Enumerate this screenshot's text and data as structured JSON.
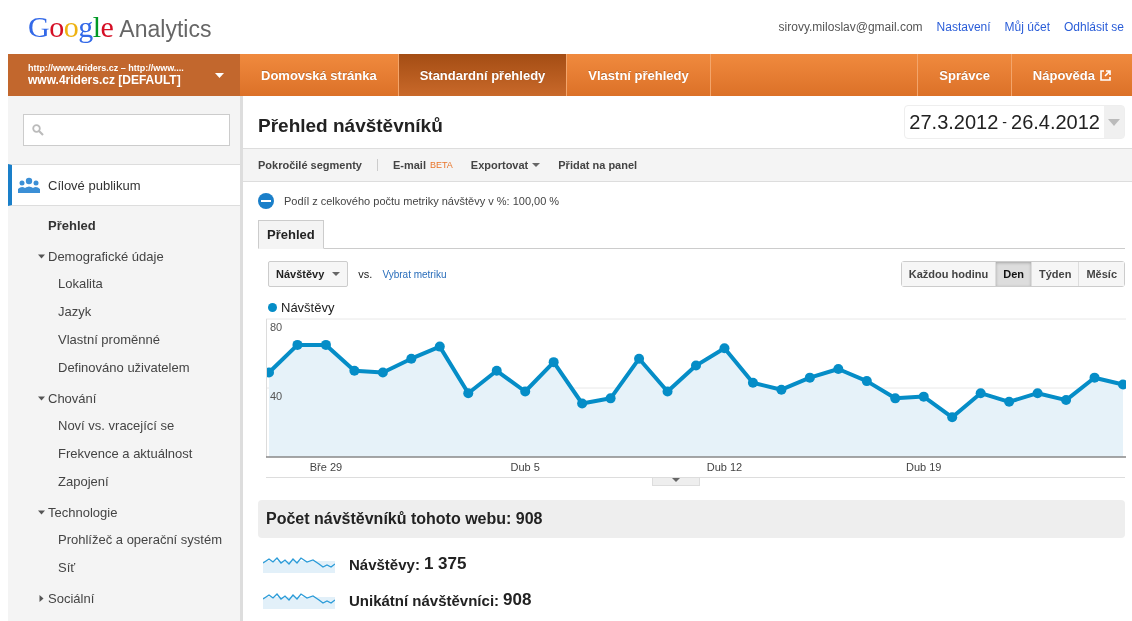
{
  "header": {
    "logo_brand": "Google",
    "logo_product": "Analytics",
    "email": "sirovy.miloslav@gmail.com",
    "links": [
      "Nastavení",
      "Můj účet",
      "Odhlásit se"
    ]
  },
  "nav": {
    "account": {
      "line1": "http://www.4riders.cz – http://www....",
      "line2": "www.4riders.cz [DEFAULT]"
    },
    "tabs": [
      {
        "label": "Domovská stránka",
        "selected": false
      },
      {
        "label": "Standardní přehledy",
        "selected": true
      },
      {
        "label": "Vlastní přehledy",
        "selected": false
      }
    ],
    "right_tabs": [
      {
        "label": "Správce",
        "external": false
      },
      {
        "label": "Nápověda",
        "external": true
      }
    ]
  },
  "sidebar": {
    "section": "Cílové publikum",
    "items": [
      {
        "label": "Přehled",
        "selected": true
      },
      {
        "label": "Demografické údaje",
        "expanded": true,
        "children": [
          {
            "label": "Lokalita",
            "selected": false
          },
          {
            "label": "Jazyk",
            "selected": false
          },
          {
            "label": "Vlastní proměnné",
            "selected": false
          },
          {
            "label": "Definováno uživatelem",
            "selected": false
          }
        ]
      },
      {
        "label": "Chování",
        "expanded": true,
        "children": [
          {
            "label": "Noví vs. vracející se",
            "selected": false
          },
          {
            "label": "Frekvence a aktuálnost",
            "selected": false
          },
          {
            "label": "Zapojení",
            "selected": false
          }
        ]
      },
      {
        "label": "Technologie",
        "expanded": true,
        "children": [
          {
            "label": "Prohlížeč a operační systém",
            "selected": false
          },
          {
            "label": "Síť",
            "selected": false
          }
        ]
      },
      {
        "label": "Sociální",
        "expanded": false
      }
    ]
  },
  "main": {
    "title": "Přehled návštěvníků",
    "date_range": {
      "start": "27.3.2012",
      "separator": "-",
      "end": "26.4.2012"
    },
    "toolbar": [
      {
        "kind": "plain",
        "label": "Pokročilé segmenty"
      },
      {
        "kind": "badge",
        "label": "E-mail",
        "badge": "BETA"
      },
      {
        "kind": "dropdown",
        "label": "Exportovat"
      },
      {
        "kind": "plain",
        "label": "Přidat na panel"
      }
    ],
    "segment_note": "Podíl z celkového počtu metriky návštěvy v %: 100,00 %",
    "tabs": [
      {
        "label": "Přehled",
        "selected": true
      }
    ],
    "metric_select": "Návštěvy",
    "vs": "vs.",
    "compare_link": "Vybrat metriku",
    "granularity": [
      {
        "label": "Každou hodinu",
        "selected": false
      },
      {
        "label": "Den",
        "selected": true
      },
      {
        "label": "Týden",
        "selected": false
      },
      {
        "label": "Měsíc",
        "selected": false
      }
    ],
    "chart_data": {
      "type": "area",
      "categories": [
        null,
        null,
        "Bře 29",
        null,
        null,
        null,
        null,
        null,
        null,
        "Dub 5",
        null,
        null,
        null,
        null,
        null,
        null,
        "Dub 12",
        null,
        null,
        null,
        null,
        null,
        null,
        "Dub 19",
        null,
        null,
        null,
        null,
        null,
        null,
        null
      ],
      "series": [
        {
          "name": "Návštěvy",
          "color": "#058dc7",
          "values": [
            49,
            65,
            65,
            50,
            49,
            57,
            64,
            37,
            50,
            38,
            55,
            31,
            34,
            57,
            38,
            53,
            63,
            43,
            39,
            46,
            51,
            44,
            34,
            35,
            23,
            37,
            32,
            37,
            33,
            46,
            42
          ]
        }
      ],
      "ylim": [
        0,
        80
      ],
      "yticks": [
        40,
        80
      ]
    },
    "summary": {
      "title": "Počet návštěvníků tohoto webu: 908",
      "metrics": [
        {
          "label": "Návštěvy:",
          "value": "1 375"
        },
        {
          "label": "Unikátní návštěvníci:",
          "value": "908"
        }
      ]
    }
  }
}
